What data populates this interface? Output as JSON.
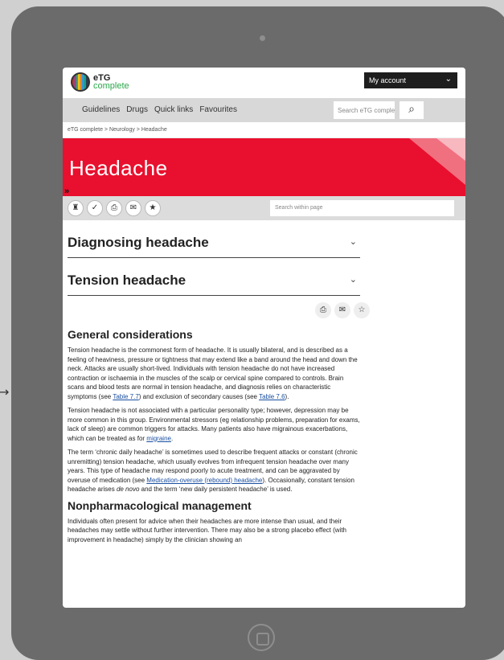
{
  "side_arrow": "→",
  "header": {
    "logo_top": "eTG",
    "logo_bottom": "complete",
    "account_label": "My account",
    "account_chevron": "⌄"
  },
  "nav": {
    "links": [
      "Guidelines",
      "Drugs",
      "Quick links",
      "Favourites"
    ],
    "search_placeholder": "Search eTG complete",
    "search_icon": "⌕"
  },
  "breadcrumb": "eTG complete > Neurology > Headache",
  "banner": {
    "title": "Headache",
    "expand": "»"
  },
  "toolbar": {
    "tools": [
      "♜",
      "✓",
      "⎙",
      "✉",
      "★"
    ],
    "search_placeholder": "Search within page"
  },
  "sections": {
    "diagnosing": "Diagnosing headache",
    "tension": "Tension headache",
    "chevron": "⌄"
  },
  "content_icons": [
    "⎙",
    "✉",
    "☆"
  ],
  "general": {
    "heading": "General considerations",
    "p1a": "Tension headache is the commonest form of headache. It is usually bilateral, and is described as a feeling of heaviness, pressure or tightness that may extend like a band around the head and down the neck. Attacks are usually short-lived. Individuals with tension headache do not have increased contraction or ischaemia in the muscles of the scalp or cervical spine compared to controls. Brain scans and blood tests are normal in tension headache, and diagnosis relies on characteristic symptoms (see ",
    "p1_link1": "Table 7.7",
    "p1b": ") and exclusion of secondary causes (see ",
    "p1_link2": "Table 7.6",
    "p1c": ").",
    "p2a": "Tension headache is not associated with a particular personality type; however, depression may be more common in this group. Environmental stressors (eg relationship problems, preparation for exams, lack of sleep) are common triggers for attacks. Many patients also have migrainous exacerbations, which can be treated as for ",
    "p2_link": "migraine",
    "p2b": ".",
    "p3a": "The term ‘chronic daily headache’ is sometimes used to describe frequent attacks or constant (chronic unremitting) tension headache, which usually evolves from infrequent tension headache over many years. This type of headache may respond poorly to acute treatment, and can be aggravated by overuse of medication (see ",
    "p3_link": "Medication-overuse (rebound) headache",
    "p3b": "). Occasionally, constant tension headache arises ",
    "p3_italic": "de novo",
    "p3c": " and the term ‘new daily persistent headache’ is used."
  },
  "nonpharm": {
    "heading": "Nonpharmacological management",
    "p1": "Individuals often present for advice when their headaches are more intense than usual, and their headaches may settle without further intervention. There may also be a strong placebo effect (with improvement in headache) simply by the clinician showing an"
  }
}
